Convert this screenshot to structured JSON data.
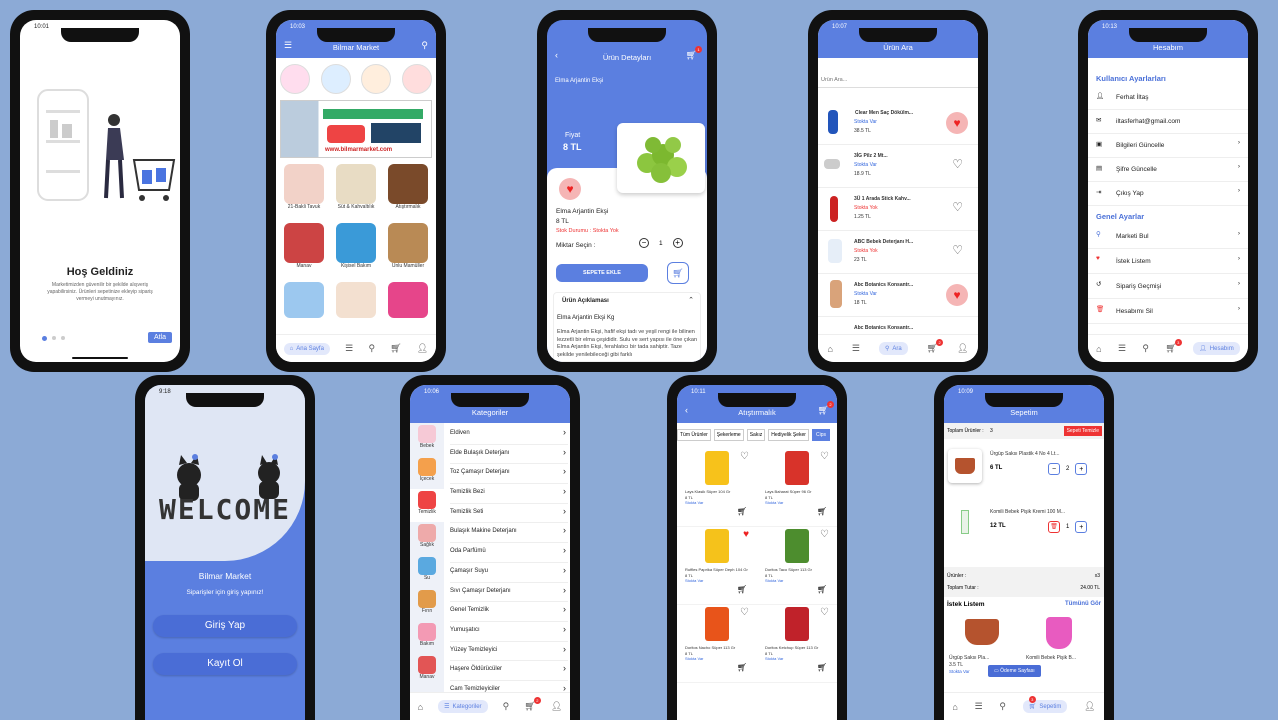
{
  "welcome": {
    "time": "10:01",
    "title": "Hoş Geldiniz",
    "text": "Marketimizden güvenilir bir şekilde alışveriş yapabilirsiniz. Ürünleri sepetinize ekleyip sipariş vermeyi unutmayınız.",
    "skip": "Atla"
  },
  "home": {
    "time": "10:03",
    "title": "Bilmar Market",
    "banner_url": "www.bilmarmarket.com",
    "categories": [
      "21-Bakli Tavuk",
      "Süt & Kahvaltılık",
      "Atıştırmalık",
      "Manav",
      "Kişisel Bakım",
      "Unlu Mamüller"
    ],
    "nav_active": "Ana Sayfa"
  },
  "detail": {
    "title": "Ürün Detayları",
    "cart_count": "1",
    "product_name": "Elma Arjantin Ekşi",
    "price_label": "Fiyat",
    "price": "8 TL",
    "name2": "Elma Arjantin Ekşi",
    "price2": "8 TL",
    "stock_label": "Stok Durumu :",
    "stock_value": "Stokta Yok",
    "qty_label": "Miktar Seçin :",
    "qty": "1",
    "add_button": "SEPETE EKLE",
    "desc_title": "Ürün Açıklaması",
    "desc_subtitle": "Elma Arjantin Ekşi Kg",
    "desc_text": "Elma Arjantin Ekşi, hafif ekşi tadı ve yeşil rengi ile bilinen lezzetli bir elma çeşididir. Sulu ve sert yapısı ile öne çıkan Elma Arjantin Ekşi, ferahlatıcı bir tada sahiptir. Taze şekilde yenilebileceği gibi farklı"
  },
  "search": {
    "time": "10:07",
    "title": "Ürün Ara",
    "placeholder": "Ürün Ara...",
    "nav_active": "Ara",
    "cart_count": "2",
    "items": [
      {
        "name": "Clear Men Saç Dökülm...",
        "stock": "Stokta Var",
        "price": "38.5 TL",
        "fav": true
      },
      {
        "name": "3İG Pilz 2 Mt...",
        "stock": "Stokta Var",
        "price": "18.9 TL",
        "fav": false
      },
      {
        "name": "3Ü 1 Arada Stick Kahv...",
        "stock": "Stokta Yok",
        "price": "1.25 TL",
        "fav": false
      },
      {
        "name": "ABC Bebek Deterjanı H...",
        "stock": "Stokta Yok",
        "price": "23 TL",
        "fav": false
      },
      {
        "name": "Abc Botanics Konsantr...",
        "stock": "Stokta Var",
        "price": "18 TL",
        "fav": true
      },
      {
        "name": "Abc Botanics Konsantr...",
        "stock": "",
        "price": "",
        "fav": false
      }
    ]
  },
  "account": {
    "time": "10:13",
    "title": "Hesabım",
    "section1": "Kullanıcı Ayarlarları",
    "user": "Ferhat İltaş",
    "email": "iltasferhat@gmail.com",
    "items1": [
      "Bilgileri Güncelle",
      "Şifre Güncelle",
      "Çıkış Yap"
    ],
    "section2": "Genel Ayarlar",
    "items2": [
      "Marketi Bul",
      "İstek Listem",
      "Sipariş Geçmişi",
      "Hesabımı Sil"
    ],
    "nav_active": "Hesabım",
    "cart_count": "3"
  },
  "login": {
    "time": "9:18",
    "welcome_art": "WELCOME",
    "store": "Bilmar Market",
    "subtitle": "Siparişler için giriş yapınız!",
    "login": "Giriş Yap",
    "register": "Kayıt Ol"
  },
  "categories": {
    "time": "10:06",
    "title": "Kategoriler",
    "side": [
      "Bebek",
      "İçecek",
      "Temizlik",
      "Sağlık",
      "Su",
      "Fırın",
      "Bakım",
      "Manav"
    ],
    "list": [
      "Eldiven",
      "Elde Bulaşık Deterjanı",
      "Toz Çamaşır Deterjanı",
      "Temizlik Bezi",
      "Temizlik Seti",
      "Bulaşık Makine Deterjanı",
      "Oda Parfümü",
      "Çamaşır Suyu",
      "Sıvı Çamaşır Deterjanı",
      "Genel Temizlik",
      "Yumuşatıcı",
      "Yüzey Temizleyici",
      "Haşere Öldürücüler",
      "Cam Temizleyiciler"
    ],
    "nav_active": "Kategoriler",
    "cart_count": "2"
  },
  "snacks": {
    "time": "10:11",
    "title": "Atıştırmalık",
    "cart_count": "2",
    "chips": [
      "Tüm Ürünler",
      "Şekerleme",
      "Sakız",
      "Hediyelik Şeker",
      "Cips"
    ],
    "products": [
      {
        "name": "Lays Klasik Süper 104 Gr",
        "price": "8 TL",
        "stock": "Stokta Var",
        "fav": false
      },
      {
        "name": "Lays Baharat Süper 96 Gr",
        "price": "8 TL",
        "stock": "Stokta Var",
        "fav": false
      },
      {
        "name": "Ruffles Paprika Süper Deph 104 Gr",
        "price": "8 TL",
        "stock": "Stokta Var",
        "fav": true
      },
      {
        "name": "Doritos Taco Süper 113 Gr",
        "price": "8 TL",
        "stock": "Stokta Var",
        "fav": false
      },
      {
        "name": "Doritos Nacho Süper 113 Gr",
        "price": "8 TL",
        "stock": "Stokta Var",
        "fav": false
      },
      {
        "name": "Doritos Ketchup Süper 113 Gr",
        "price": "8 TL",
        "stock": "Stokta Var",
        "fav": false
      }
    ]
  },
  "cart": {
    "time": "10:09",
    "title": "Sepetim",
    "total_items_label": "Toplam Ürünler :",
    "total_items": "3",
    "clear": "Sepeti Temizle",
    "items": [
      {
        "name": "Ürgüp Saksı Plastik 4 No 4 Lt...",
        "price": "6 TL",
        "qty": "2"
      },
      {
        "name": "Komili Bebek Pişik Kremi 100 M...",
        "price": "12 TL",
        "qty": "1"
      }
    ],
    "products_label": "Ürünler :",
    "products_count": "x3",
    "total_label": "Toplam Tutar :",
    "total": "24.00 TL",
    "wishlist": "İstek Listem",
    "see_all": "Tümünü Gör",
    "wish_items": [
      {
        "name": "Ürgüp Saksı Pla...",
        "price": "3.5 TL",
        "stock": "Stokta Var"
      },
      {
        "name": "Komili Bebek Pişik B...",
        "price": "",
        "stock": ""
      }
    ],
    "checkout": "Ödeme Sayfası",
    "nav_active": "Sepetim",
    "cart_count": "3"
  },
  "colors": {
    "primary": "#5b7fe0",
    "bg": "#8caad6",
    "danger": "#e33333"
  }
}
